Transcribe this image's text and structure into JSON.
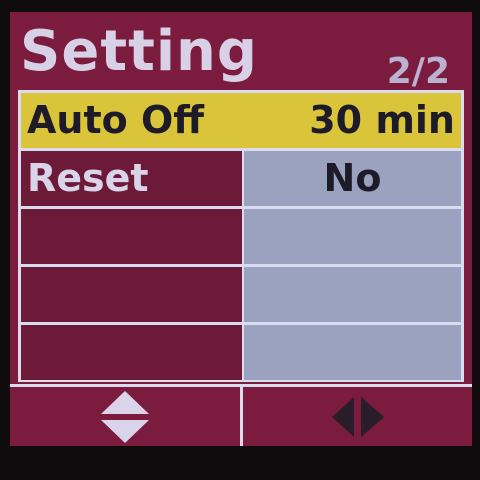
{
  "header": {
    "title": "Setting",
    "page_indicator": "2/2"
  },
  "menu": {
    "items": [
      {
        "label": "Auto Off",
        "value": "30 min",
        "selected": true
      },
      {
        "label": "Reset",
        "value": "No",
        "selected": false
      },
      {
        "label": "",
        "value": "",
        "selected": false
      },
      {
        "label": "",
        "value": "",
        "selected": false
      },
      {
        "label": "",
        "value": "",
        "selected": false
      }
    ]
  },
  "softkeys": {
    "left_icon": "up-down-arrows-icon",
    "right_icon": "left-right-arrows-icon"
  },
  "colors": {
    "background": "#7b1b3d",
    "selection": "#d9c43a",
    "value_cell": "#9aa2bf",
    "grid_lines": "#d9dcef",
    "text_light": "#d9d4ea",
    "text_dark": "#1e1b29"
  }
}
